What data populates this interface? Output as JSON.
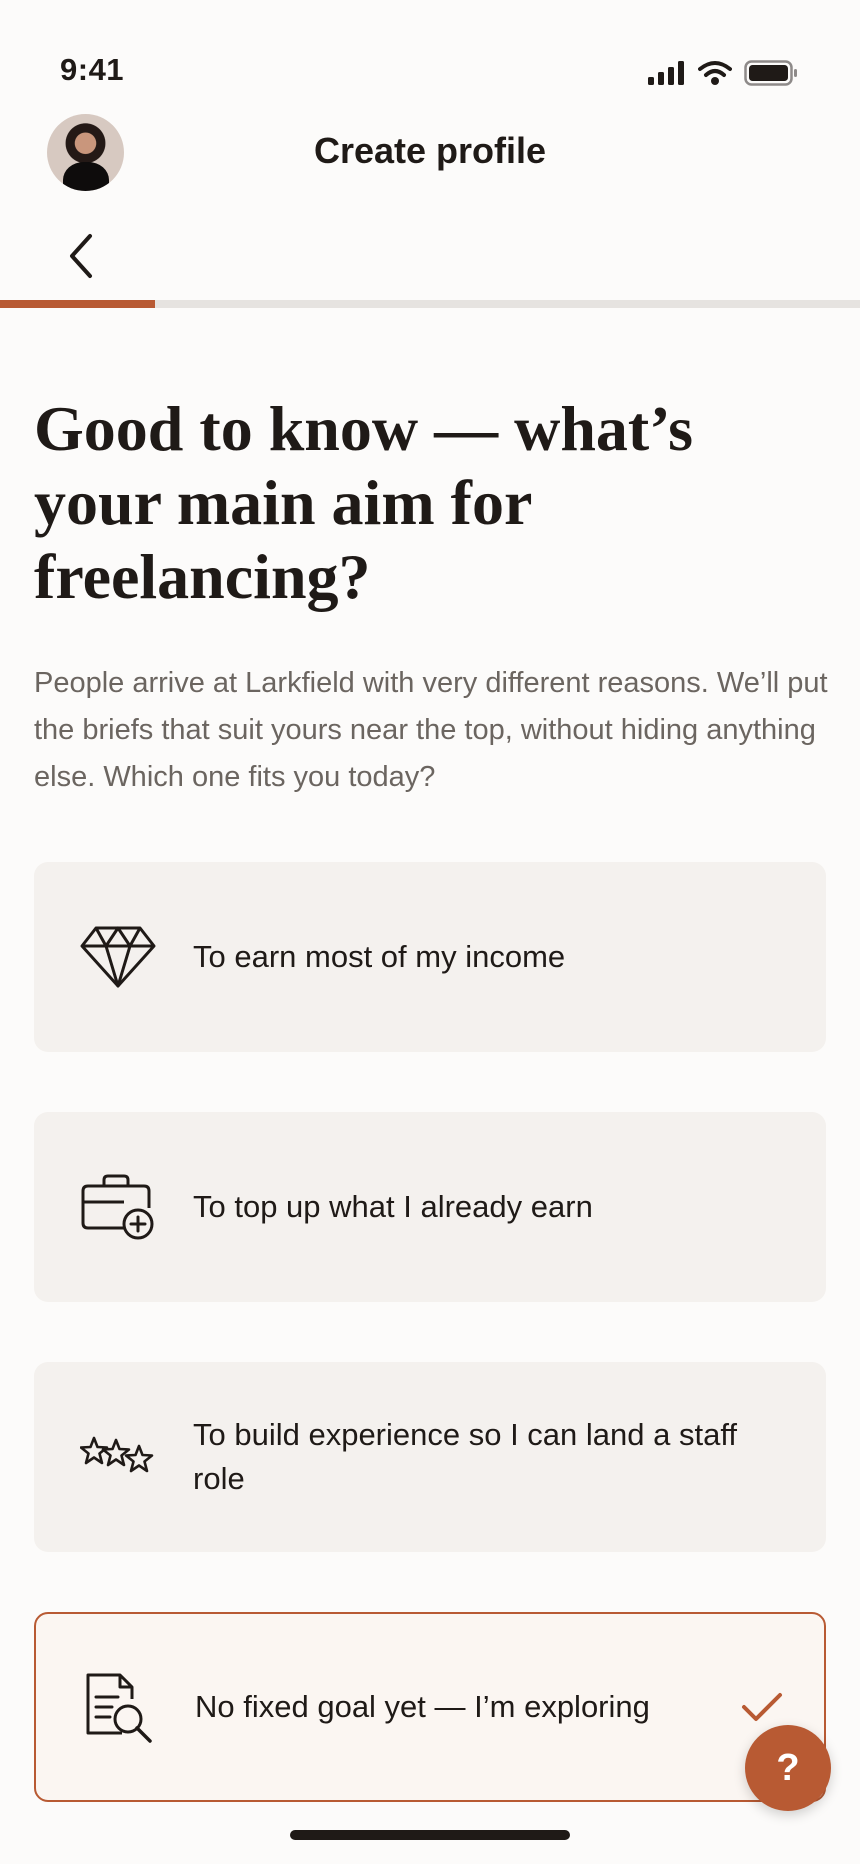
{
  "status_bar": {
    "time": "9:41",
    "icons": [
      "signal-icon",
      "wifi-icon",
      "battery-icon"
    ]
  },
  "header": {
    "title": "Create profile",
    "avatar": "avatar",
    "back_icon": "chevron-left-icon"
  },
  "progress": {
    "fraction": 0.18,
    "color": "#b85a33"
  },
  "content": {
    "heading": "Good to know — what’s your main aim for freelancing?",
    "subtitle": "People arrive at Larkfield with very different reasons. We’ll put the briefs that suit yours near the top, without hiding anything else. Which one fits you today?"
  },
  "options": [
    {
      "label": "To earn most of my income",
      "icon": "diamond-icon",
      "selected": false
    },
    {
      "label": "To top up what I already earn",
      "icon": "briefcase-plus-icon",
      "selected": false
    },
    {
      "label": "To build experience so I can land a staff role",
      "icon": "stars-icon",
      "selected": false
    },
    {
      "label": "No fixed goal yet — I’m exploring",
      "icon": "document-search-icon",
      "selected": true
    }
  ],
  "help_button": {
    "label": "?"
  },
  "colors": {
    "accent": "#b85a33",
    "background": "#fcfbfa",
    "option_bg": "#f4f1ee"
  }
}
